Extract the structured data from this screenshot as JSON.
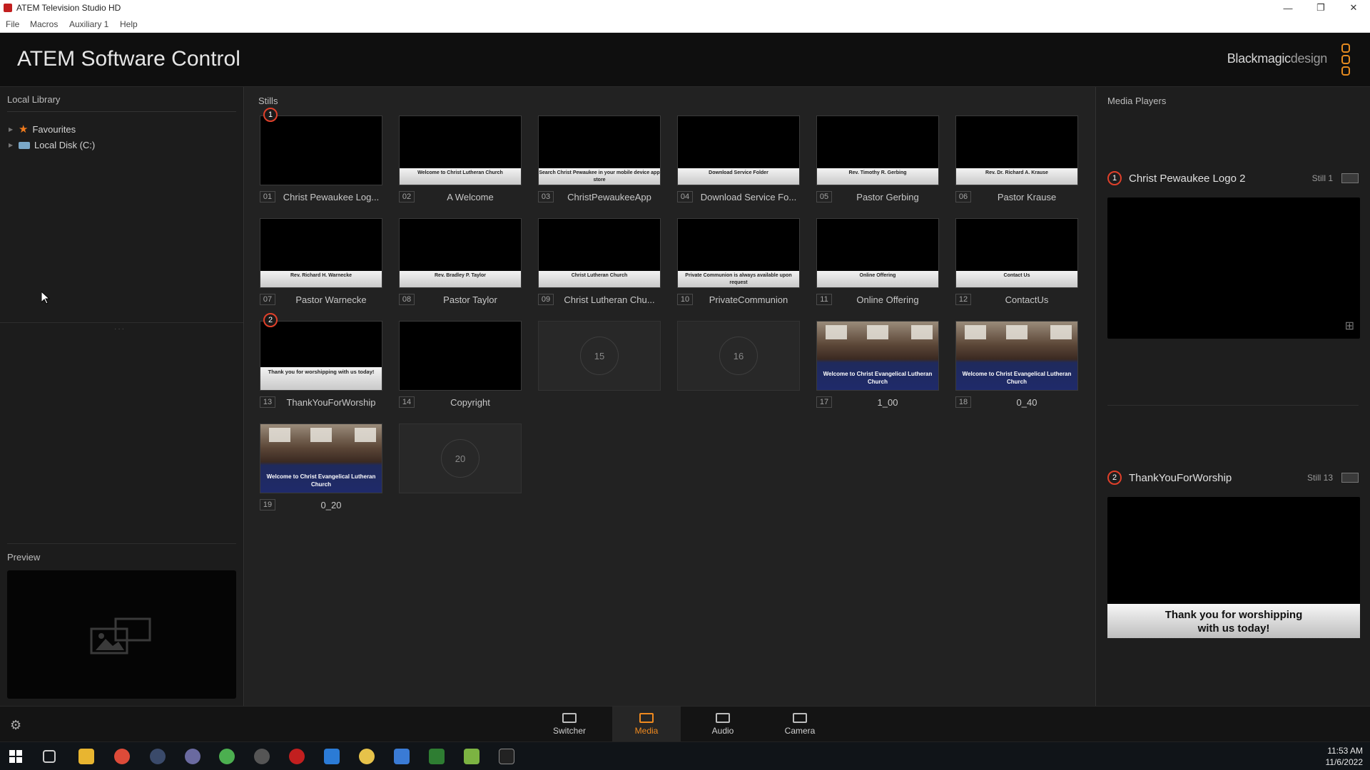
{
  "window": {
    "title": "ATEM Television Studio HD",
    "minimize": "—",
    "restore": "❐",
    "close": "✕"
  },
  "menu": [
    "File",
    "Macros",
    "Auxiliary 1",
    "Help"
  ],
  "header": {
    "app_title": "ATEM Software Control",
    "brand_main": "Blackmagic",
    "brand_sub": "design"
  },
  "library": {
    "heading": "Local Library",
    "items": [
      {
        "label": "Favourites",
        "icon": "star-icon"
      },
      {
        "label": "Local Disk (C:)",
        "icon": "disk-icon"
      }
    ],
    "preview_heading": "Preview"
  },
  "stills": {
    "heading": "Stills",
    "tiles": [
      {
        "num": "01",
        "name": "Christ Pewaukee Log...",
        "band": "",
        "marker": "1"
      },
      {
        "num": "02",
        "name": "A Welcome",
        "band": "Welcome to Christ Lutheran Church"
      },
      {
        "num": "03",
        "name": "ChristPewaukeeApp",
        "band": "Search Christ Pewaukee in your mobile device app store"
      },
      {
        "num": "04",
        "name": "Download Service Fo...",
        "band": "Download Service Folder"
      },
      {
        "num": "05",
        "name": "Pastor Gerbing",
        "band": "Rev. Timothy R. Gerbing"
      },
      {
        "num": "06",
        "name": "Pastor Krause",
        "band": "Rev. Dr. Richard A. Krause"
      },
      {
        "num": "07",
        "name": "Pastor Warnecke",
        "band": "Rev. Richard H. Warnecke"
      },
      {
        "num": "08",
        "name": "Pastor Taylor",
        "band": "Rev. Bradley P. Taylor"
      },
      {
        "num": "09",
        "name": "Christ Lutheran Chu...",
        "band": "Christ Lutheran Church"
      },
      {
        "num": "10",
        "name": "PrivateCommunion",
        "band": "Private Communion is always available upon request"
      },
      {
        "num": "11",
        "name": "Online Offering",
        "band": "Online Offering"
      },
      {
        "num": "12",
        "name": "ContactUs",
        "band": "Contact Us"
      },
      {
        "num": "13",
        "name": "ThankYouForWorship",
        "band": "Thank you for worshipping with us today!",
        "marker": "2"
      },
      {
        "num": "14",
        "name": "Copyright",
        "band": ""
      },
      {
        "num": "15",
        "name": "",
        "empty": true
      },
      {
        "num": "16",
        "name": "",
        "empty": true
      },
      {
        "num": "17",
        "name": "1_00",
        "church": true
      },
      {
        "num": "18",
        "name": "0_40",
        "church": true
      },
      {
        "num": "19",
        "name": "0_20",
        "church": true
      },
      {
        "num": "20",
        "name": "",
        "empty": true
      }
    ],
    "church_text": "Welcome to Christ Evangelical Lutheran Church"
  },
  "media_players": {
    "heading": "Media Players",
    "players": [
      {
        "num": "1",
        "title": "Christ Pewaukee Logo 2",
        "still": "Still 1",
        "band": ""
      },
      {
        "num": "2",
        "title": "ThankYouForWorship",
        "still": "Still 13",
        "band_line1": "Thank you for worshipping",
        "band_line2": "with us today!"
      }
    ]
  },
  "nav": {
    "tabs": [
      "Switcher",
      "Media",
      "Audio",
      "Camera"
    ],
    "active": "Media"
  },
  "taskbar": {
    "time": "11:53 AM",
    "date": "11/6/2022"
  },
  "colors": {
    "accent": "#f08a1f",
    "marker": "#e0402a"
  }
}
